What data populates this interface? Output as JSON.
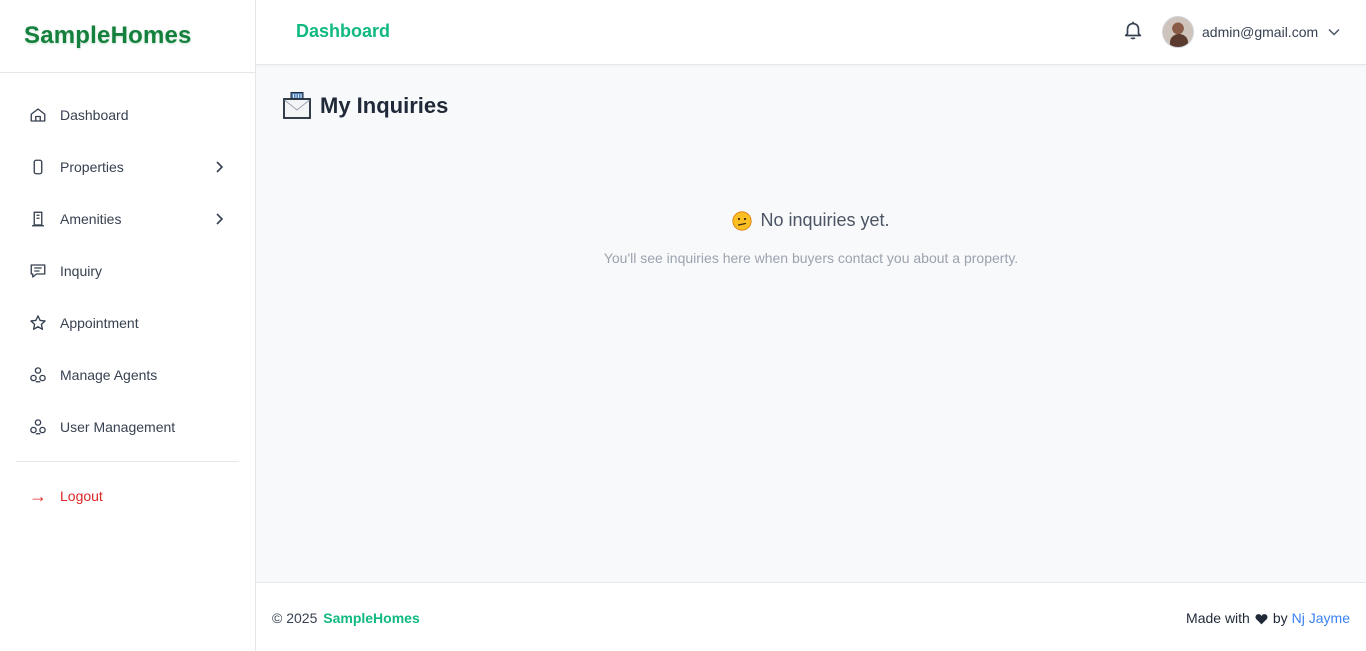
{
  "brand": {
    "name": "SampleHomes"
  },
  "header": {
    "title": "Dashboard",
    "user_email": "admin@gmail.com"
  },
  "sidebar": {
    "items": [
      {
        "label": "Dashboard",
        "icon": "home-icon",
        "has_submenu": false
      },
      {
        "label": "Properties",
        "icon": "phone-icon",
        "has_submenu": true
      },
      {
        "label": "Amenities",
        "icon": "building-icon",
        "has_submenu": true
      },
      {
        "label": "Inquiry",
        "icon": "chat-icon",
        "has_submenu": false
      },
      {
        "label": "Appointment",
        "icon": "star-icon",
        "has_submenu": false
      },
      {
        "label": "Manage Agents",
        "icon": "users-icon",
        "has_submenu": false
      },
      {
        "label": "User Management",
        "icon": "users-icon",
        "has_submenu": false
      }
    ],
    "logout_label": "Logout"
  },
  "main": {
    "page_title": "My Inquiries",
    "empty_title": "No inquiries yet.",
    "empty_subtitle": "You'll see inquiries here when buyers contact you about a property."
  },
  "footer": {
    "copyright": "© 2025",
    "brand": "SampleHomes",
    "made_with": "Made with",
    "by": "by",
    "author": "Nj Jayme"
  },
  "colors": {
    "brand_green": "#15803d",
    "accent_green": "#10b981",
    "danger": "#dc2626",
    "link_blue": "#3b82f6"
  }
}
